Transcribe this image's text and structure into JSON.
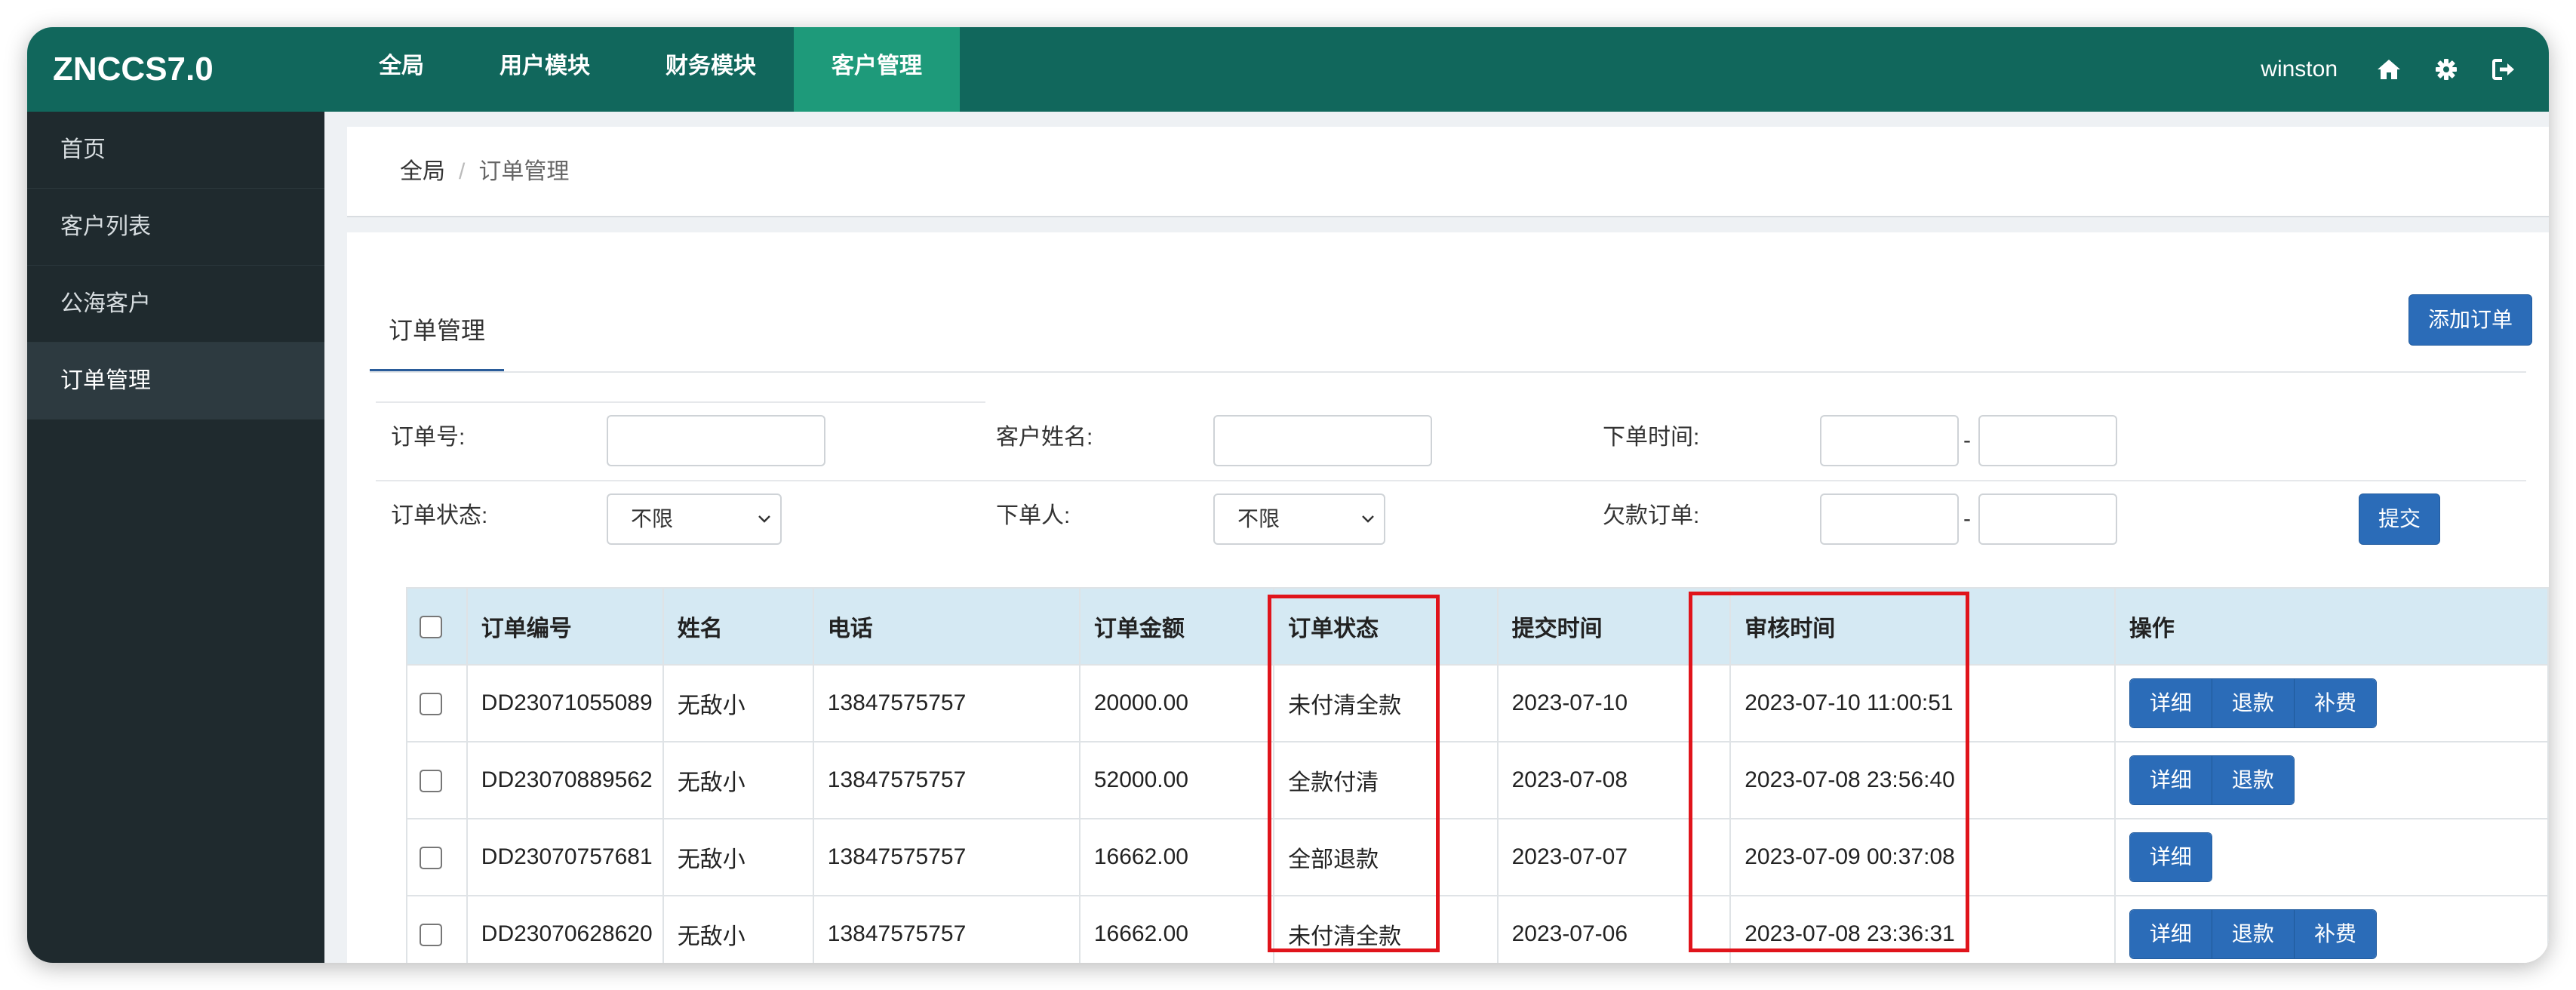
{
  "app": {
    "logo": "ZNCCS7.0",
    "nav": [
      "全局",
      "用户模块",
      "财务模块",
      "客户管理"
    ],
    "active_nav": 3,
    "username": "winston"
  },
  "sidebar": {
    "items": [
      "首页",
      "客户列表",
      "公海客户",
      "订单管理"
    ],
    "active": 3
  },
  "breadcrumb": {
    "home": "全局",
    "separator": "/",
    "current": "订单管理"
  },
  "panel": {
    "tab": "订单管理",
    "add_button": "添加订单"
  },
  "filters": {
    "order_no_label": "订单号:",
    "order_no_value": "",
    "customer_label": "客户姓名:",
    "customer_value": "",
    "time_label": "下单时间:",
    "time_from": "",
    "time_to": "",
    "range_sep": "-",
    "status_label": "订单状态:",
    "status_value": "不限",
    "creator_label": "下单人:",
    "creator_value": "不限",
    "debt_label": "欠款订单:",
    "debt_from": "",
    "debt_to": "",
    "submit": "提交"
  },
  "table": {
    "headers": [
      "订单编号",
      "姓名",
      "电话",
      "订单金额",
      "订单状态",
      "提交时间",
      "审核时间",
      "操作"
    ],
    "rows": [
      {
        "id": "DD23071055089",
        "name": "无敌小",
        "phone": "13847575757",
        "amount": "20000.00",
        "status": "未付清全款",
        "submitted": "2023-07-10",
        "reviewed": "2023-07-10 11:00:51",
        "actions": [
          "详细",
          "退款",
          "补费"
        ]
      },
      {
        "id": "DD23070889562",
        "name": "无敌小",
        "phone": "13847575757",
        "amount": "52000.00",
        "status": "全款付清",
        "submitted": "2023-07-08",
        "reviewed": "2023-07-08 23:56:40",
        "actions": [
          "详细",
          "退款"
        ]
      },
      {
        "id": "DD23070757681",
        "name": "无敌小",
        "phone": "13847575757",
        "amount": "16662.00",
        "status": "全部退款",
        "submitted": "2023-07-07",
        "reviewed": "2023-07-09 00:37:08",
        "actions": [
          "详细"
        ]
      },
      {
        "id": "DD23070628620",
        "name": "无敌小",
        "phone": "13847575757",
        "amount": "16662.00",
        "status": "未付清全款",
        "submitted": "2023-07-06",
        "reviewed": "2023-07-08 23:36:31",
        "actions": [
          "详细",
          "退款",
          "补费"
        ]
      }
    ]
  },
  "colors": {
    "topbar": "#11675c",
    "active_nav": "#1e9a7a",
    "sidebar": "#1f2a2e",
    "primary_button": "#2b6cb8",
    "table_header": "#d5e9f3",
    "highlight": "#e0141b"
  },
  "icons": {
    "home": "home-icon",
    "settings": "gear-icon",
    "logout": "logout-icon",
    "select_arrow": "chevron-down-icon"
  }
}
